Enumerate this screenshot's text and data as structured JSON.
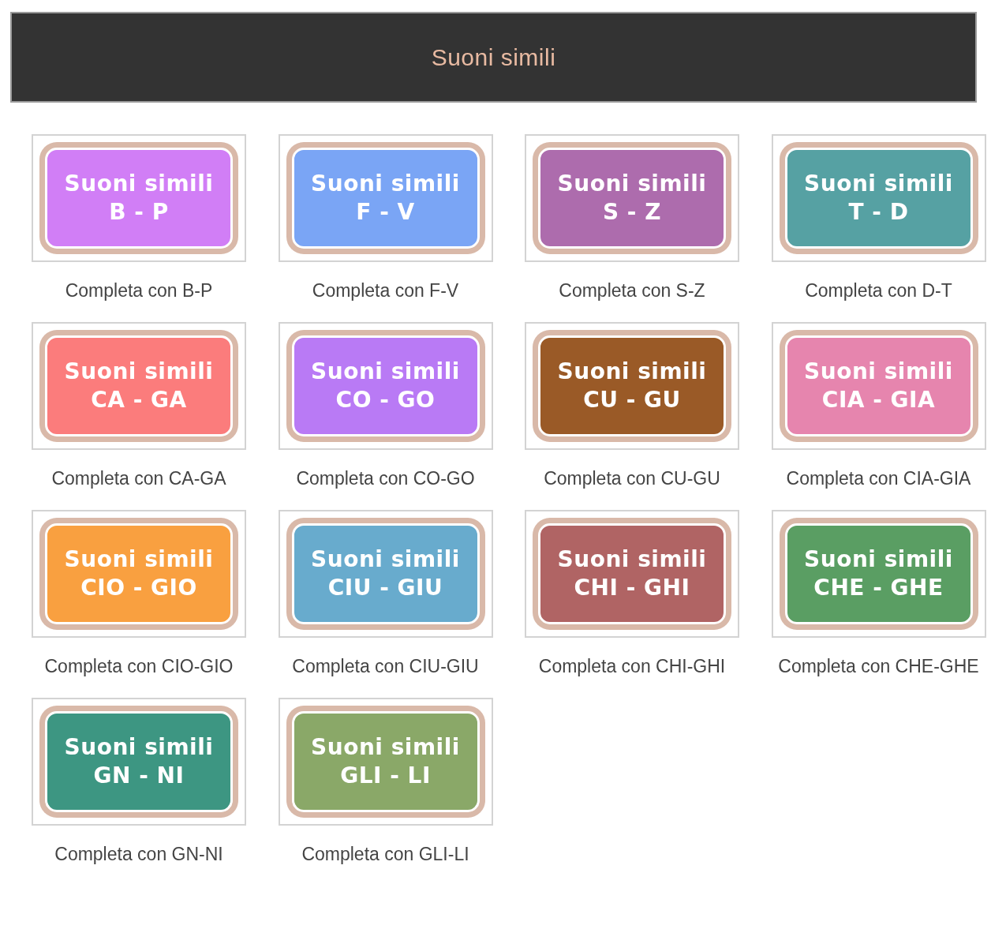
{
  "header": {
    "title": "Suoni simili"
  },
  "cards": [
    {
      "badge_title": "Suoni simili",
      "badge_letters": "B - P",
      "color": "#d17ef6",
      "caption": "Completa con B-P"
    },
    {
      "badge_title": "Suoni simili",
      "badge_letters": "F - V",
      "color": "#7aa5f5",
      "caption": "Completa con F-V"
    },
    {
      "badge_title": "Suoni simili",
      "badge_letters": "S - Z",
      "color": "#ad6cad",
      "caption": "Completa con S-Z"
    },
    {
      "badge_title": "Suoni simili",
      "badge_letters": "T - D",
      "color": "#56a1a3",
      "caption": "Completa con D-T"
    },
    {
      "badge_title": "Suoni simili",
      "badge_letters": "CA - GA",
      "color": "#fb7c7c",
      "caption": "Completa con CA-GA"
    },
    {
      "badge_title": "Suoni simili",
      "badge_letters": "CO - GO",
      "color": "#b97af5",
      "caption": "Completa con CO-GO"
    },
    {
      "badge_title": "Suoni simili",
      "badge_letters": "CU - GU",
      "color": "#9a5a27",
      "caption": "Completa con CU-GU"
    },
    {
      "badge_title": "Suoni simili",
      "badge_letters": "CIA - GIA",
      "color": "#e685ae",
      "caption": "Completa con CIA-GIA"
    },
    {
      "badge_title": "Suoni simili",
      "badge_letters": "CIO - GIO",
      "color": "#f9a040",
      "caption": "Completa con CIO-GIO"
    },
    {
      "badge_title": "Suoni simili",
      "badge_letters": "CIU - GIU",
      "color": "#68abcd",
      "caption": "Completa con CIU-GIU"
    },
    {
      "badge_title": "Suoni simili",
      "badge_letters": "CHI - GHI",
      "color": "#b06464",
      "caption": "Completa con CHI-GHI"
    },
    {
      "badge_title": "Suoni simili",
      "badge_letters": "CHE - GHE",
      "color": "#5a9e63",
      "caption": "Completa con CHE-GHE"
    },
    {
      "badge_title": "Suoni simili",
      "badge_letters": "GN - NI",
      "color": "#3d9682",
      "caption": "Completa con GN-NI"
    },
    {
      "badge_title": "Suoni simili",
      "badge_letters": "GLI - LI",
      "color": "#8aa868",
      "caption": "Completa con GLI-LI"
    }
  ]
}
